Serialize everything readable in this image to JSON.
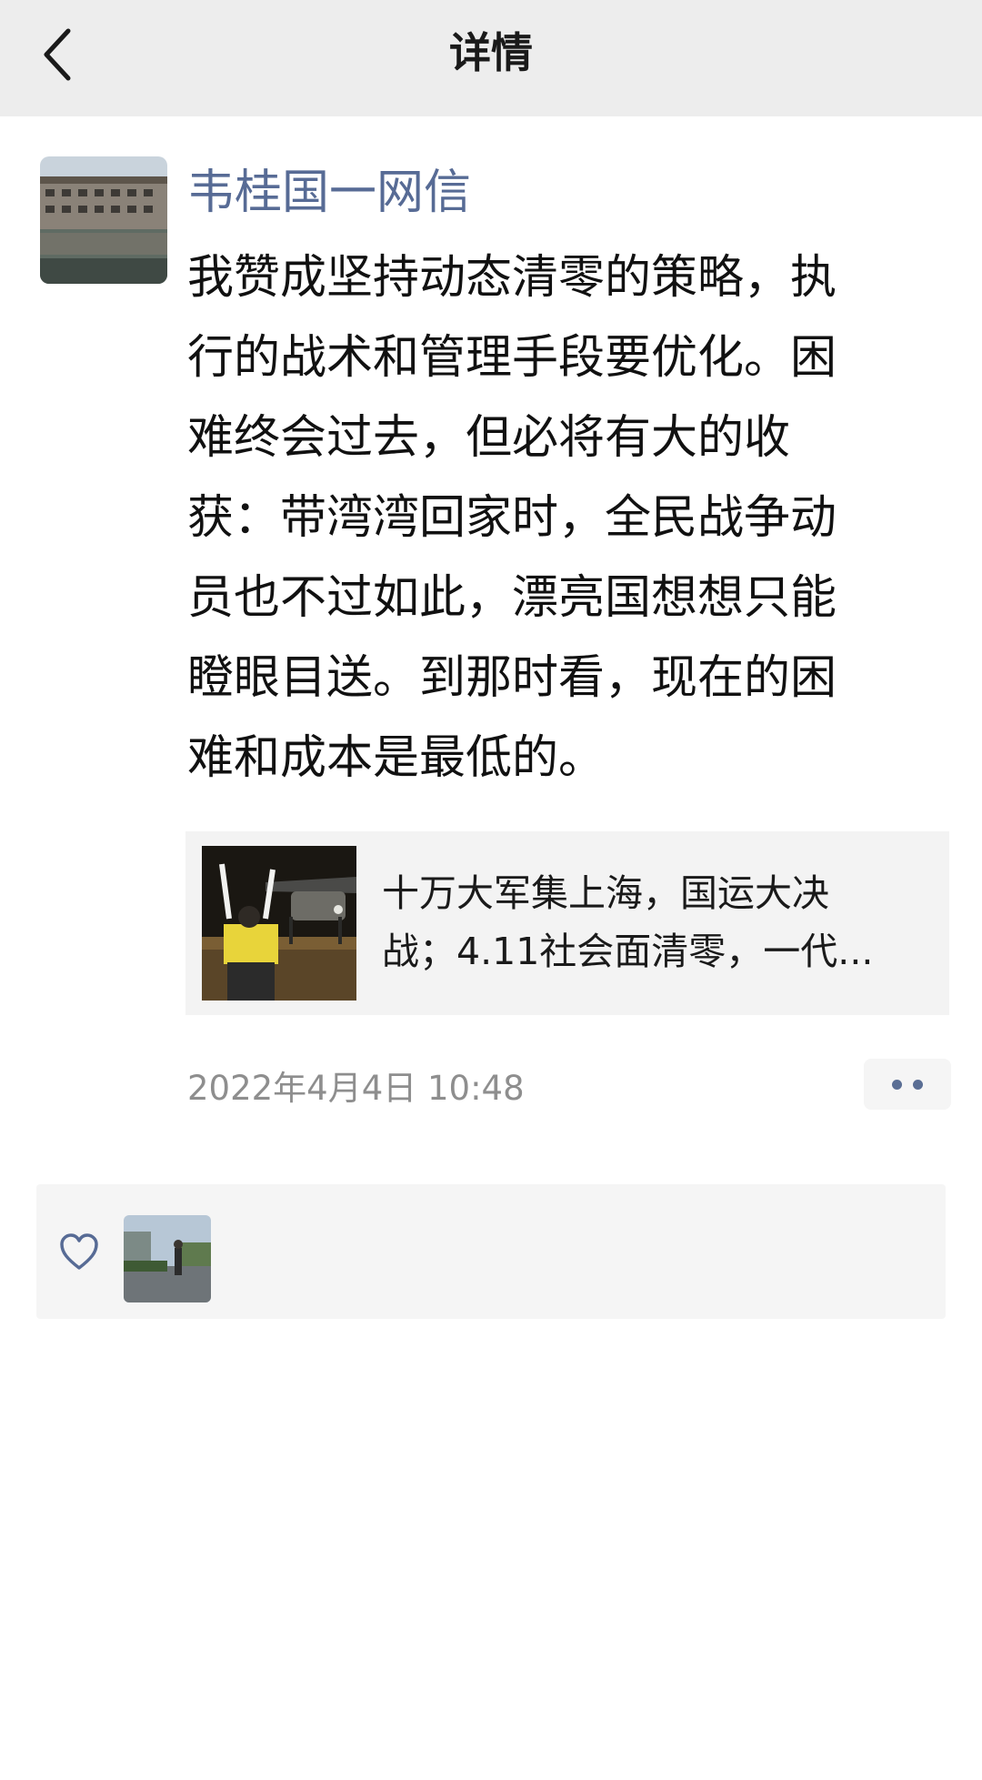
{
  "header": {
    "title": "详情",
    "back_icon": "chevron-left-icon"
  },
  "post": {
    "author": "韦桂国一网信",
    "lines": [
      "我赞成坚持动态清零的策略，执",
      "行的战术和管理手段要优化。困",
      "难终会过去，但必将有大的收",
      "获：带湾湾回家时，全民战争动",
      "员也不过如此，漂亮国想想只能",
      "瞪眼目送。到那时看，现在的困",
      "难和成本是最低的。"
    ],
    "link": {
      "title_line1": "十万大军集上海，国运大决",
      "title_line2": "战；4.11社会面清零，一代..."
    },
    "time": "2022年4月4日 10:48",
    "more_icon": "more-dots-icon"
  },
  "likes": {
    "icon": "heart-icon"
  },
  "colors": {
    "header_bg": "#ededed",
    "author": "#576b95",
    "card_bg": "#f3f3f3",
    "time": "#8e8e8e"
  }
}
